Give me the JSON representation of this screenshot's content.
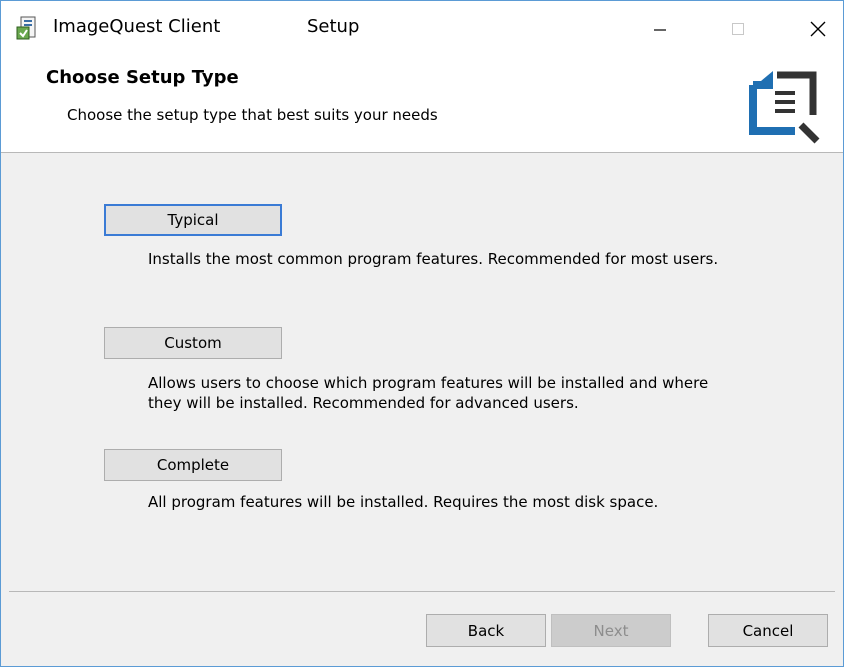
{
  "window": {
    "app_title": "ImageQuest Client",
    "title_suffix": "Setup",
    "controls": {
      "minimize_icon": "minimize-icon",
      "maximize_icon": "maximize-icon",
      "close_icon": "close-icon"
    }
  },
  "banner": {
    "title": "Choose Setup Type",
    "subtitle": "Choose the setup type that best suits your needs",
    "logo_icon": "document-search-icon"
  },
  "options": [
    {
      "label": "Typical",
      "description": "Installs the most common program features. Recommended for most users."
    },
    {
      "label": "Custom",
      "description_line1": "Allows users to choose which program features will be installed and where",
      "description_line2": "they will be installed. Recommended for advanced users."
    },
    {
      "label": "Complete",
      "description": "All program features will be installed. Requires the most disk space."
    }
  ],
  "footer": {
    "back_label": "Back",
    "next_label": "Next",
    "cancel_label": "Cancel"
  },
  "colors": {
    "accent": "#3a7bd5",
    "logo_blue": "#1f6fb2",
    "logo_dark": "#333333"
  }
}
